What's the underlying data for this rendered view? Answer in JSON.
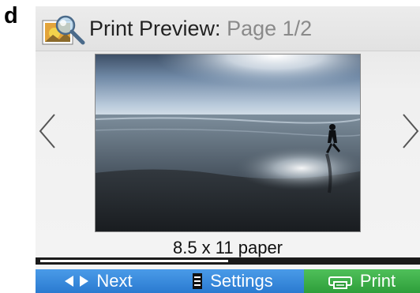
{
  "figure_letter": "d",
  "header": {
    "icon": "print-preview-magnifier-icon",
    "title_main": "Print Preview:",
    "title_page": "Page 1/2"
  },
  "navigation": {
    "left_icon": "chevron-left-icon",
    "right_icon": "chevron-right-icon"
  },
  "preview": {
    "image": "beach-silhouette-photo",
    "paper_label": "8.5 x 11 paper"
  },
  "progress": {
    "fraction": 0.5
  },
  "softkeys": {
    "next": {
      "label": "Next",
      "icon": "left-right-arrows-icon"
    },
    "settings": {
      "label": "Settings",
      "icon": "settings-list-icon"
    },
    "print": {
      "label": "Print",
      "icon": "printer-icon"
    }
  },
  "colors": {
    "blue_softkey": "#2a7ad0",
    "green_softkey": "#2e9e3a",
    "title_page_gray": "#8a8a8a"
  }
}
